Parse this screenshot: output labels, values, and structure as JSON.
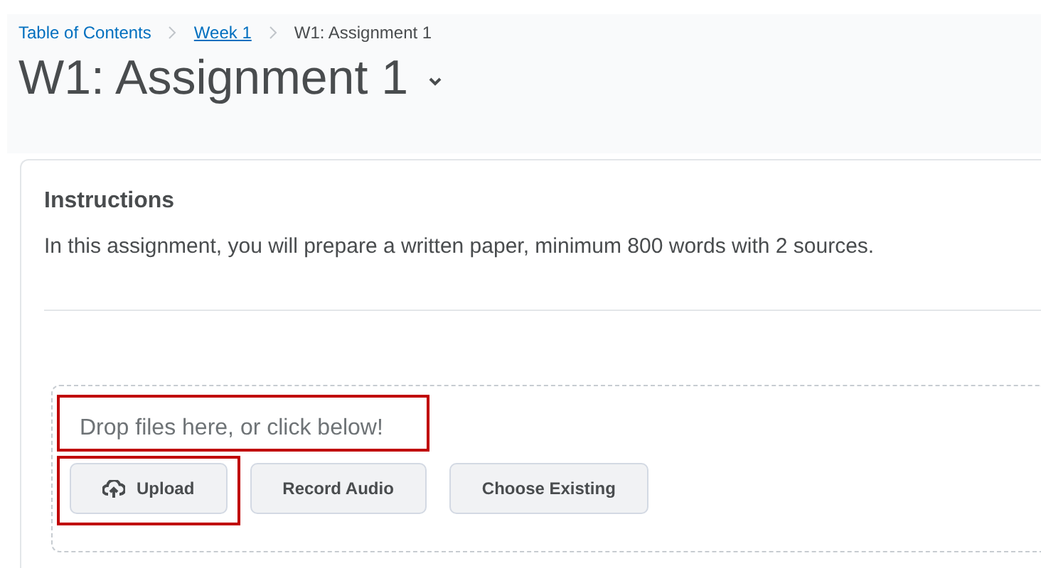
{
  "breadcrumbs": [
    {
      "label": "Table of Contents",
      "kind": "link"
    },
    {
      "label": "Week 1",
      "kind": "underlined"
    },
    {
      "label": "W1: Assignment 1",
      "kind": "current"
    }
  ],
  "page_title": "W1: Assignment 1",
  "instructions": {
    "heading": "Instructions",
    "text": "In this assignment, you will prepare a written paper, minimum 800 words with 2 sources."
  },
  "dropzone": {
    "prompt": "Drop files here, or click below!",
    "highlighted": true
  },
  "buttons": [
    {
      "label": "Upload",
      "kind": "upload",
      "highlighted": true
    },
    {
      "label": "Record Audio",
      "kind": "record",
      "highlighted": false
    },
    {
      "label": "Choose Existing",
      "kind": "choose",
      "highlighted": false
    }
  ]
}
